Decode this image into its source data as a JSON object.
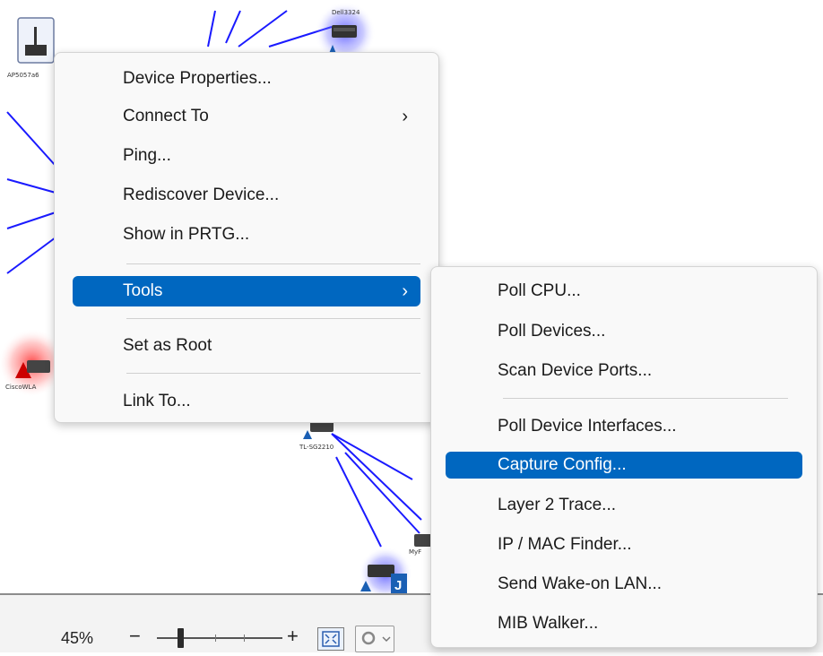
{
  "canvas": {
    "link_color": "#1a1aff",
    "nodes": [
      {
        "id": "node-top-left",
        "label": "AP5057a6"
      },
      {
        "id": "node-top-right",
        "label": "Dell3324"
      },
      {
        "id": "node-left-red",
        "label": "CiscoWLA"
      },
      {
        "id": "node-middle",
        "label": "TL-SG2210"
      },
      {
        "id": "node-bottom",
        "label": "MyF"
      }
    ]
  },
  "context_menu": {
    "items": [
      {
        "label": "Device Properties...",
        "submenu": false
      },
      {
        "label": "Connect To",
        "submenu": true
      },
      {
        "label": "Ping...",
        "submenu": false
      },
      {
        "label": "Rediscover Device...",
        "submenu": false
      },
      {
        "label": "Show in PRTG...",
        "submenu": false
      },
      {
        "label": "Tools",
        "submenu": true,
        "highlighted": true
      },
      {
        "label": "Set as Root",
        "submenu": false
      },
      {
        "label": "Link To...",
        "submenu": false
      }
    ],
    "arrow_glyph": "›"
  },
  "tools_submenu": {
    "items": [
      {
        "label": "Poll CPU..."
      },
      {
        "label": "Poll Devices..."
      },
      {
        "label": "Scan Device Ports..."
      },
      {
        "label": "Poll Device Interfaces..."
      },
      {
        "label": "Capture Config...",
        "highlighted": true
      },
      {
        "label": "Layer 2 Trace..."
      },
      {
        "label": "IP / MAC Finder..."
      },
      {
        "label": "Send Wake-on LAN..."
      },
      {
        "label": "MIB Walker..."
      }
    ]
  },
  "zoombar": {
    "zoom_level": "45%",
    "zoom_out_label": "−",
    "zoom_in_label": "+",
    "zoom_fraction": 0.19
  },
  "colors": {
    "highlight": "#0067c0",
    "menu_bg": "#f9f9f9"
  }
}
